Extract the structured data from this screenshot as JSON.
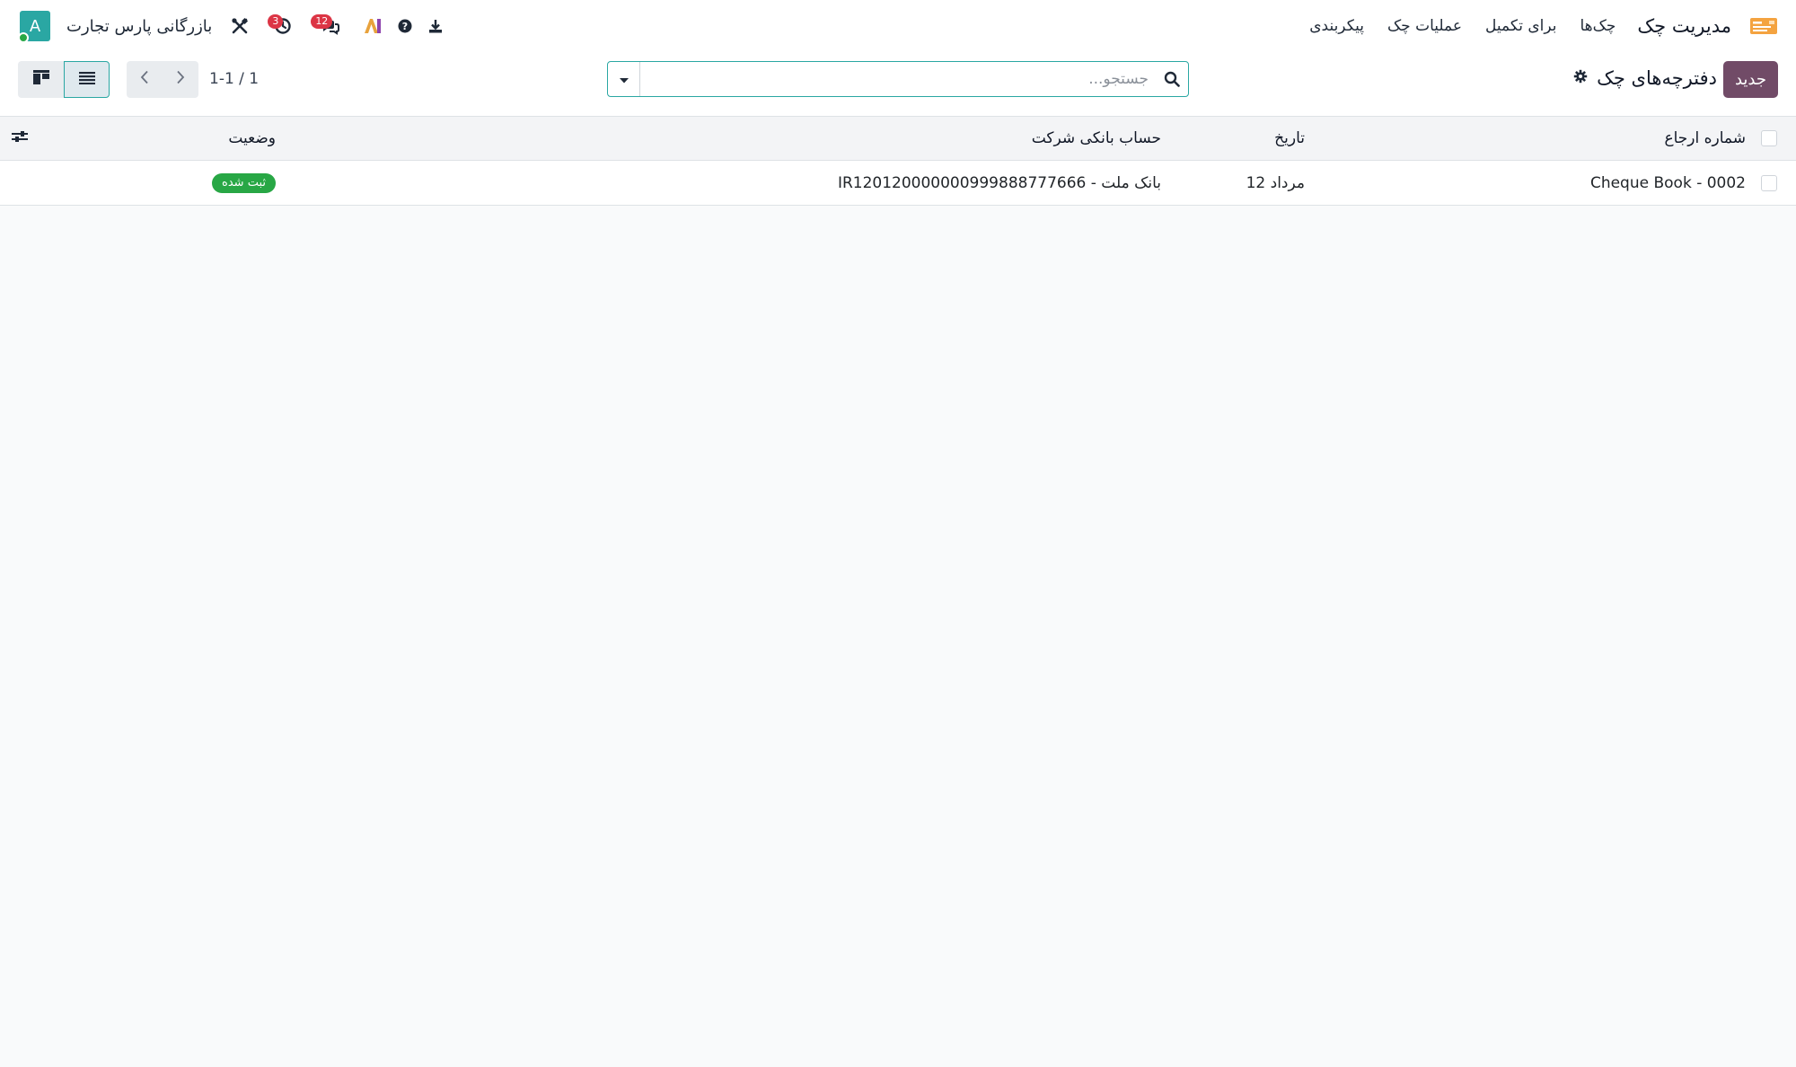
{
  "topbar": {
    "app_title": "مدیریت چک",
    "nav": [
      "چک‌ها",
      "برای تکمیل",
      "عملیات چک",
      "پیکربندی"
    ],
    "company": "بازرگانی پارس تجارت",
    "avatar_letter": "A",
    "messages_count": "12",
    "activities_count": "3",
    "icons": [
      "app-cheque-icon",
      "download-icon",
      "help-icon",
      "ai-icon",
      "chat-icon",
      "clock-icon",
      "tools-icon"
    ]
  },
  "control": {
    "new_button": "جدید",
    "breadcrumb": "دفترچه‌های چک",
    "search_placeholder": "جستجو...",
    "pager": "1-1 / 1"
  },
  "table": {
    "columns": {
      "reference": "شماره ارجاع",
      "date": "تاریخ",
      "bank_account": "حساب بانکی شرکت",
      "status": "وضعیت"
    },
    "rows": [
      {
        "reference": "Cheque Book - 0002",
        "date": "12 مرداد",
        "bank_account": "IR120120000000999888777666 - بانک ملت",
        "status": "ثبت شده"
      }
    ]
  },
  "colors": {
    "primary": "#714b67",
    "accent": "#2aa7a3",
    "success": "#28a745",
    "danger": "#dc3545"
  }
}
